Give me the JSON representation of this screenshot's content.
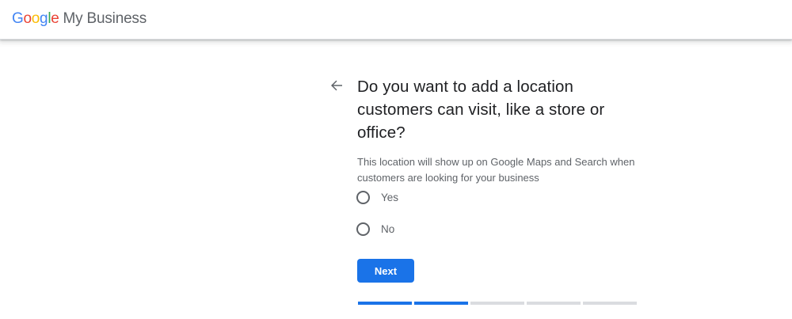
{
  "header": {
    "logo_letters": [
      {
        "char": "G",
        "color": "#4285F4"
      },
      {
        "char": "o",
        "color": "#EA4335"
      },
      {
        "char": "o",
        "color": "#FBBC05"
      },
      {
        "char": "g",
        "color": "#4285F4"
      },
      {
        "char": "l",
        "color": "#34A853"
      },
      {
        "char": "e",
        "color": "#EA4335"
      }
    ],
    "product_name": "My Business"
  },
  "back": {
    "icon": "arrow-back-icon"
  },
  "question": {
    "title": "Do you want to add a location customers can visit, like a store or office?",
    "description": "This location will show up on Google Maps and Search when customers are looking for your business"
  },
  "options": [
    {
      "label": "Yes",
      "selected": false
    },
    {
      "label": "No",
      "selected": false
    }
  ],
  "actions": {
    "next_label": "Next"
  },
  "progress": {
    "total_steps": 5,
    "completed_steps": 2,
    "active_color": "#1a73e8",
    "inactive_color": "#dadce0"
  }
}
